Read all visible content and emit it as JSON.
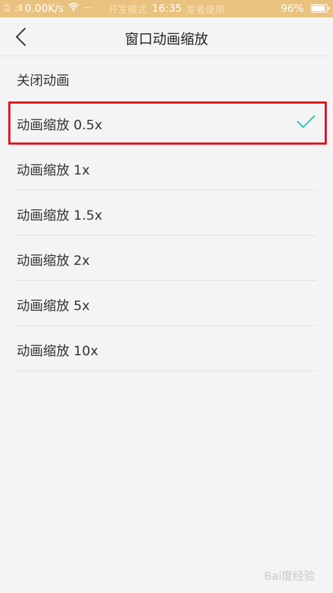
{
  "status_bar": {
    "network_label_top": "4G",
    "network_label_bottom": "2G",
    "signal": ".:ll",
    "speed": "0.00K/s",
    "more": "···",
    "developer_mode": "开发模式",
    "time": "16:35",
    "developer_use": "发者使用",
    "battery_percent": "96%",
    "battery_level": 0.96
  },
  "header": {
    "title": "窗口动画缩放"
  },
  "options": [
    {
      "label": "关闭动画",
      "selected": false
    },
    {
      "label": "动画缩放 0.5x",
      "selected": true
    },
    {
      "label": "动画缩放 1x",
      "selected": false
    },
    {
      "label": "动画缩放 1.5x",
      "selected": false
    },
    {
      "label": "动画缩放 2x",
      "selected": false
    },
    {
      "label": "动画缩放 5x",
      "selected": false
    },
    {
      "label": "动画缩放 10x",
      "selected": false
    }
  ],
  "colors": {
    "status_bar_bg": "#e8c27e",
    "check_accent": "#35c0b8",
    "highlight_border": "#e60012"
  },
  "watermark": "Bai度经验"
}
